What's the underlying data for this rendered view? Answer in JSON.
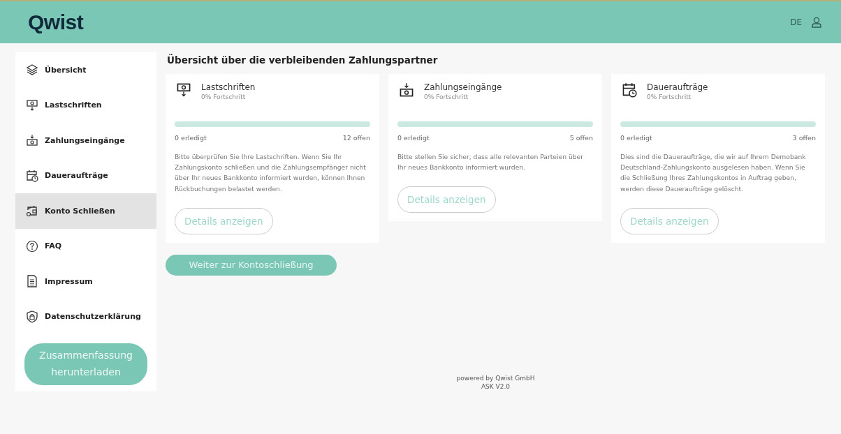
{
  "header": {
    "logo": "Qwist",
    "language": "DE"
  },
  "sidebar": {
    "items": [
      {
        "label": "Übersicht",
        "kind": "layers",
        "selected": false
      },
      {
        "label": "Lastschriften",
        "kind": "outgoing",
        "selected": false
      },
      {
        "label": "Zahlungseingänge",
        "kind": "incoming",
        "selected": false
      },
      {
        "label": "Daueraufträge",
        "kind": "recurring",
        "selected": false
      },
      {
        "label": "Konto Schließen",
        "kind": "close",
        "selected": true
      },
      {
        "label": "FAQ",
        "kind": "faq",
        "selected": false
      },
      {
        "label": "Impressum",
        "kind": "imprint",
        "selected": false
      },
      {
        "label": "Datenschutzerklärung",
        "kind": "privacy",
        "selected": false
      }
    ],
    "download_button": "Zusammenfassung herunterladen"
  },
  "main": {
    "title": "Übersicht über die verbleibenden Zahlungspartner",
    "cards": [
      {
        "kind": "outgoing",
        "title": "Lastschriften",
        "progress_text": "0% Fortschritt",
        "level": 0,
        "done": "0 erledigt",
        "open": "12 offen",
        "description": "Bitte überprüfen Sie Ihre Lastschriften. Wenn Sie Ihr Zahlungskonto schließen und die Zahlungsempfänger nicht über Ihr neues Bankkonto informiert wurden, können Ihnen Rückbuchungen belastet werden.",
        "button": "Details anzeigen"
      },
      {
        "kind": "incoming",
        "title": "Zahlungseingänge",
        "progress_text": "0% Fortschritt",
        "level": 0,
        "done": "0 erledigt",
        "open": "5 offen",
        "description": "Bitte stellen Sie sicher, dass alle relevanten Parteien über Ihr neues Bankkonto informiert wurden.",
        "button": "Details anzeigen"
      },
      {
        "kind": "recurring",
        "title": "Daueraufträge",
        "progress_text": "0% Fortschritt",
        "level": 0,
        "done": "0 erledigt",
        "open": "3 offen",
        "description": "Dies sind die Daueraufträge, die wir auf Ihrem Demobank Deutschland-Zahlungskonto ausgelesen haben. Wenn Sie die Schließung Ihres Zahlungskontos in Auftrag geben, werden diese Daueraufträge gelöscht.",
        "button": "Details anzeigen"
      }
    ],
    "continue_button": "Weiter zur Kontoschließung"
  },
  "footer": {
    "powered_by": "powered by Qwist GmbH",
    "version": "ASK V2.0"
  }
}
